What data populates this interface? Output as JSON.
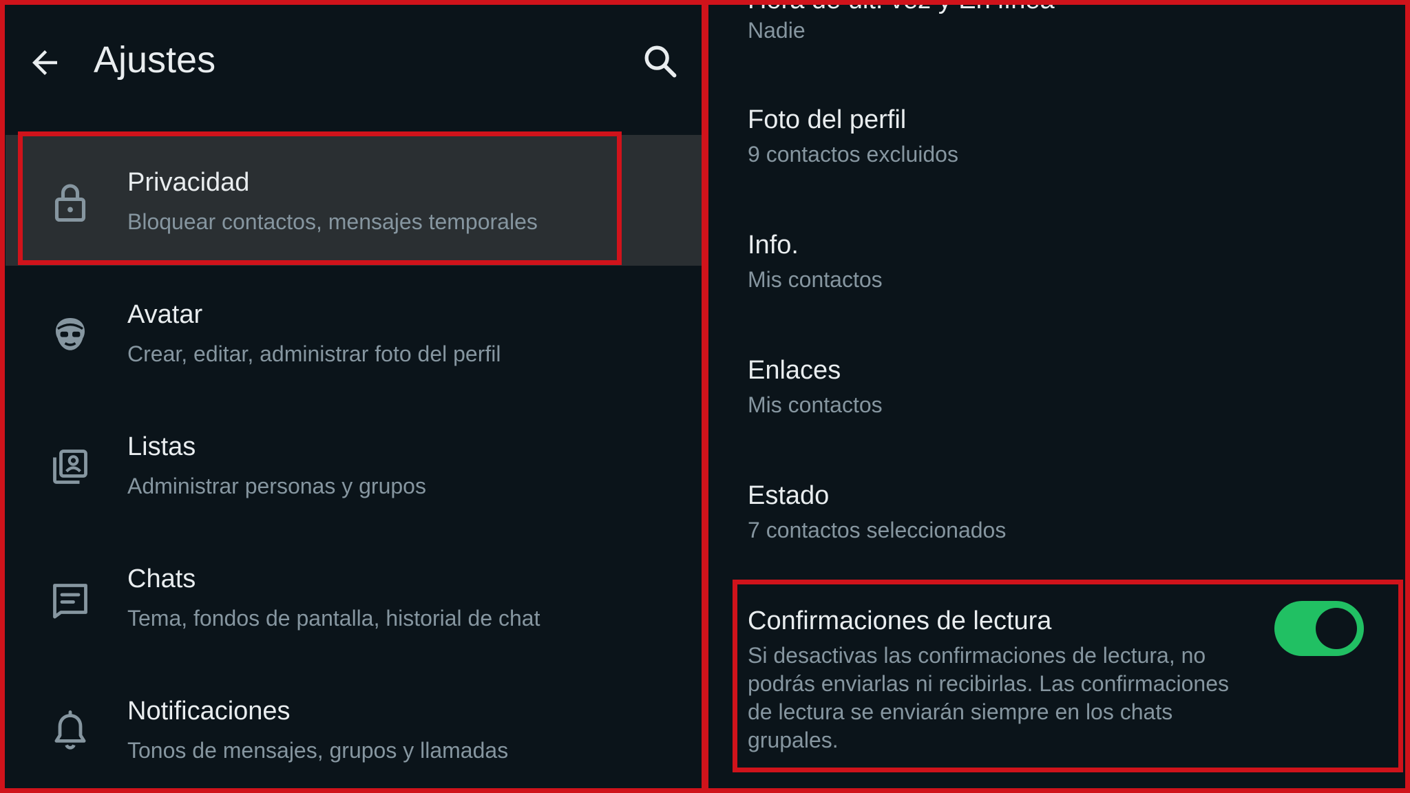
{
  "header": {
    "title": "Ajustes",
    "back_icon": "arrow-left-icon",
    "search_icon": "search-icon"
  },
  "settings_list": [
    {
      "label": "Privacidad",
      "sublabel": "Bloquear contactos, mensajes temporales",
      "icon": "lock-icon",
      "selected": true
    },
    {
      "label": "Avatar",
      "sublabel": "Crear, editar, administrar foto del perfil",
      "icon": "avatar-icon",
      "selected": false
    },
    {
      "label": "Listas",
      "sublabel": "Administrar personas y grupos",
      "icon": "lists-icon",
      "selected": false
    },
    {
      "label": "Chats",
      "sublabel": "Tema, fondos de pantalla, historial de chat",
      "icon": "chat-icon",
      "selected": false
    },
    {
      "label": "Notificaciones",
      "sublabel": "Tonos de mensajes, grupos y llamadas",
      "icon": "bell-icon",
      "selected": false
    }
  ],
  "privacy": {
    "cut_off_label": "Hora de últ. vez y En línea",
    "items": [
      {
        "label": "",
        "value": "Nadie"
      },
      {
        "label": "Foto del perfil",
        "value": "9 contactos excluidos"
      },
      {
        "label": "Info.",
        "value": "Mis contactos"
      },
      {
        "label": "Enlaces",
        "value": "Mis contactos"
      },
      {
        "label": "Estado",
        "value": "7 contactos seleccionados"
      }
    ],
    "read_receipts": {
      "label": "Confirmaciones de lectura",
      "description": "Si desactivas las confirmaciones de lectura, no podrás enviarlas ni recibirlas. Las confirmaciones de lectura se enviarán siempre en los chats grupales.",
      "enabled": true
    }
  },
  "colors": {
    "background": "#0b141a",
    "highlight_border": "#d0131b",
    "selected_row": "#2a2f32",
    "toggle_on": "#21c063",
    "primary_text": "#e9edef",
    "secondary_text": "#8696a0"
  }
}
